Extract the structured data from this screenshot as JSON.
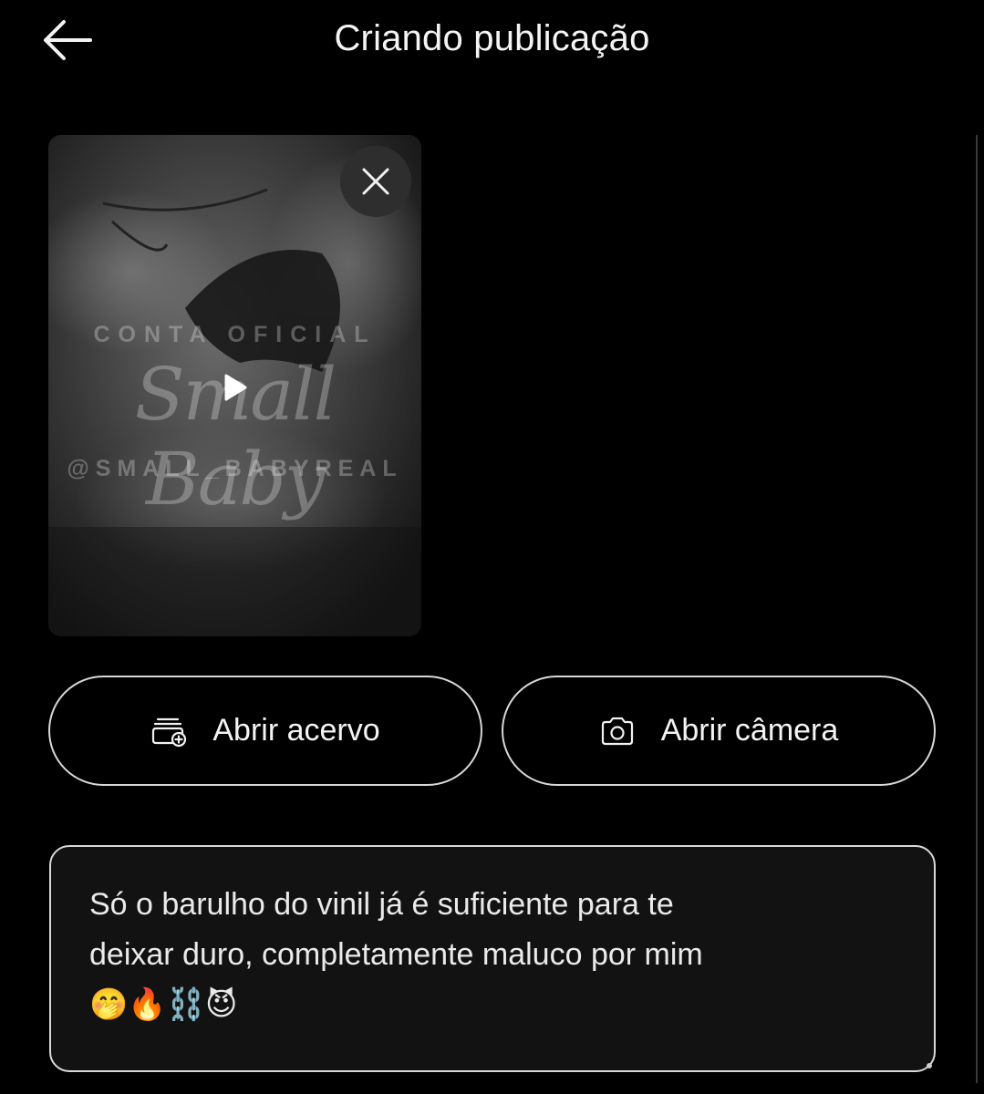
{
  "header": {
    "title": "Criando publicação",
    "back_icon": "arrow-left-icon"
  },
  "media": {
    "type": "video",
    "watermark_top": "CONTA OFICIAL",
    "watermark_script": "Small Baby",
    "watermark_handle": "@SMALL_BABYREAL",
    "play_icon": "play-icon",
    "remove_icon": "close-icon"
  },
  "actions": {
    "open_gallery_label": "Abrir acervo",
    "open_gallery_icon": "gallery-add-icon",
    "open_camera_label": "Abrir câmera",
    "open_camera_icon": "camera-icon"
  },
  "caption": {
    "text": "Só o barulho do vinil já é suficiente para te\ndeixar duro, completamente maluco por mim\n🤭🔥⛓️😈"
  },
  "colors": {
    "background": "#000000",
    "text": "#f4f4f4",
    "border": "#d8d8d8",
    "caption_background": "#121212"
  }
}
